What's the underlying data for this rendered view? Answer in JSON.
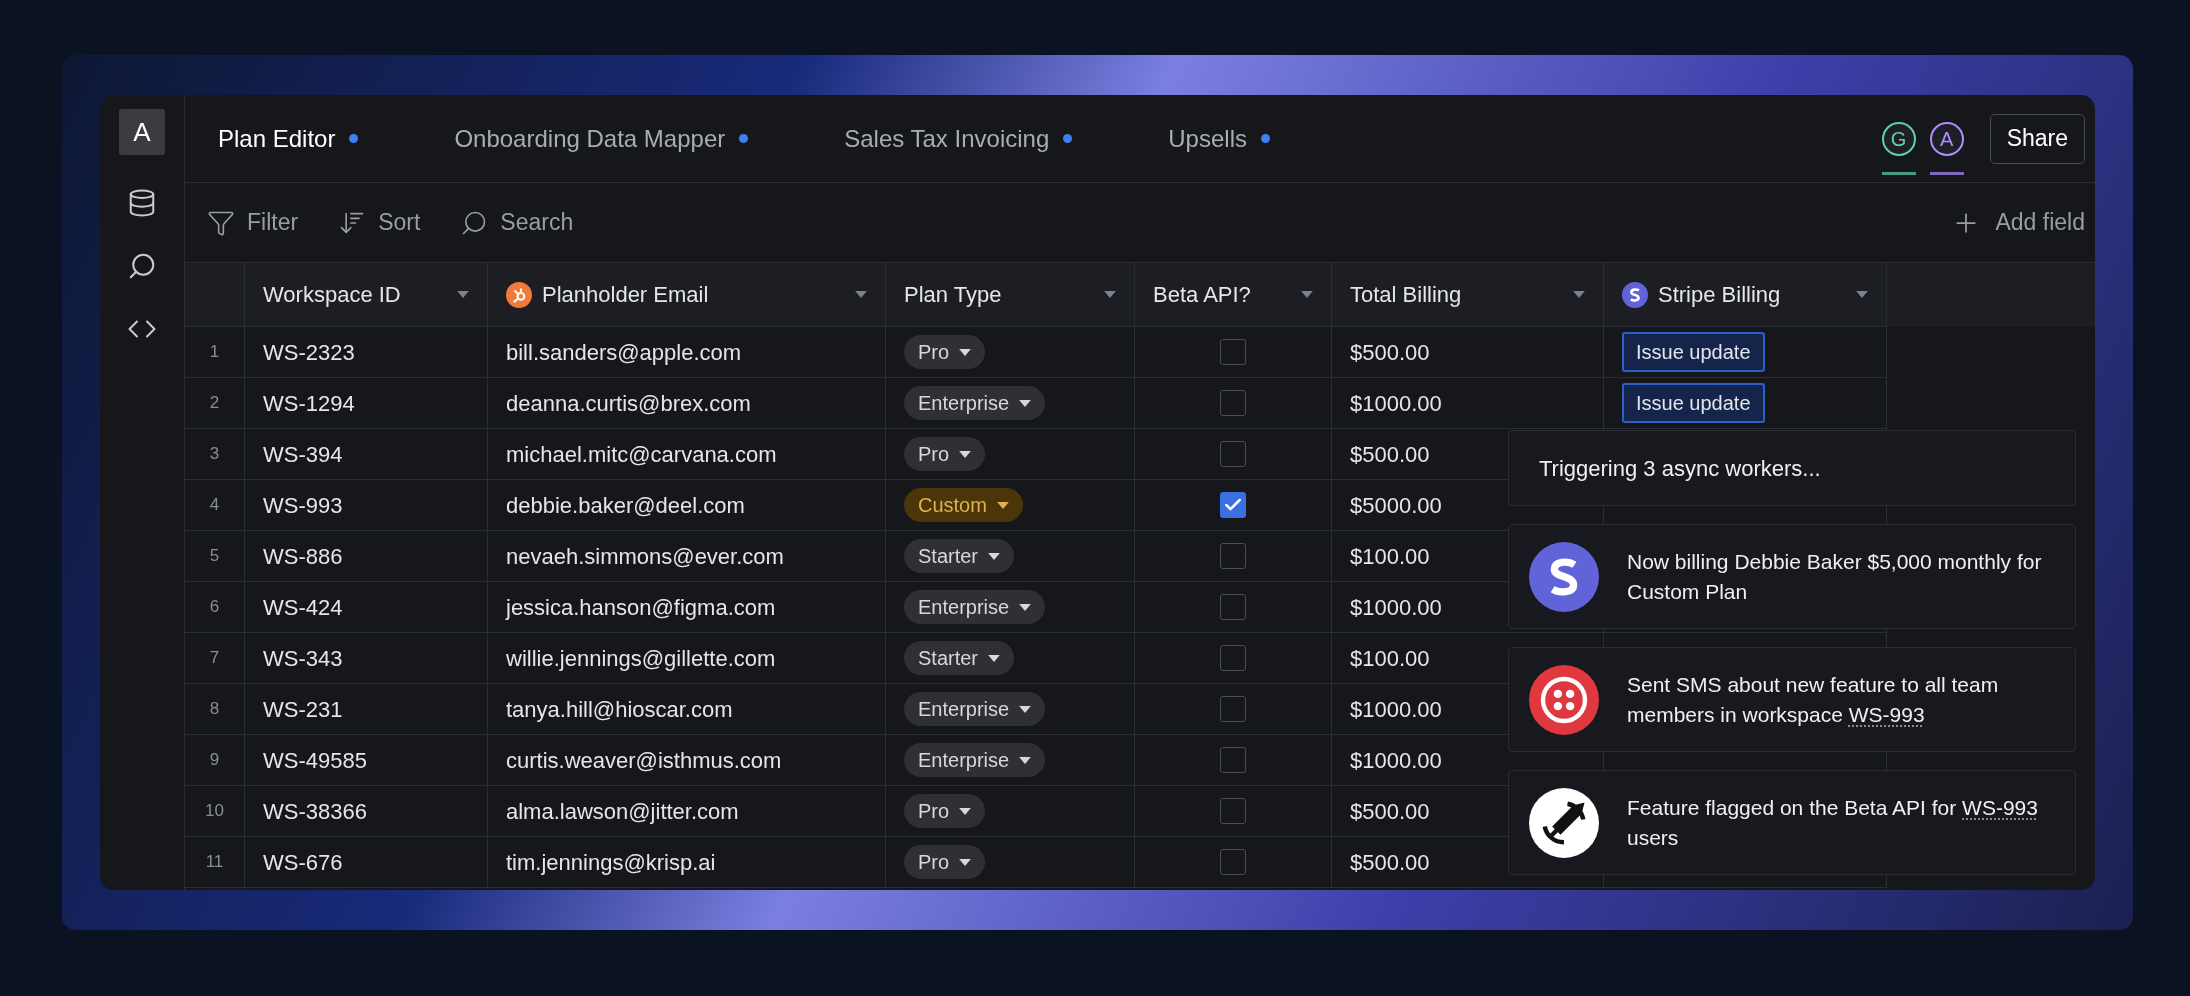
{
  "sidebar": {
    "logo": "A",
    "items": [
      {
        "kind": "database",
        "selected": false
      },
      {
        "kind": "search",
        "selected": false
      },
      {
        "kind": "code",
        "selected": false
      }
    ]
  },
  "tabs": [
    {
      "label": "Plan Editor",
      "selected": true
    },
    {
      "label": "Onboarding Data Mapper",
      "selected": false
    },
    {
      "label": "Sales Tax Invoicing",
      "selected": false
    },
    {
      "label": "Upsells",
      "selected": false
    }
  ],
  "collaborators": [
    {
      "initial": "G",
      "color": "#5fd0b0"
    },
    {
      "initial": "A",
      "color": "#b08cff"
    }
  ],
  "share_button": "Share",
  "toolbar": {
    "filter": "Filter",
    "sort": "Sort",
    "search": "Search",
    "add_field": "Add field"
  },
  "table": {
    "columns": [
      {
        "label": "Workspace ID",
        "kind": "plain"
      },
      {
        "label": "Planholder Email",
        "kind": "hubspot"
      },
      {
        "label": "Plan Type",
        "kind": "plain"
      },
      {
        "label": "Beta API?",
        "kind": "plain"
      },
      {
        "label": "Total Billing",
        "kind": "plain"
      },
      {
        "label": "Stripe Billing",
        "kind": "stripe"
      }
    ],
    "rows": [
      {
        "number": "1",
        "id": "WS-2323",
        "email": "bill.sanders@apple.com",
        "plan": {
          "label": "Pro",
          "color": "#2f3034"
        },
        "beta": false,
        "billing": "$500.00",
        "action": "Issue update"
      },
      {
        "number": "2",
        "id": "WS-1294",
        "email": "deanna.curtis@brex.com",
        "plan": {
          "label": "Enterprise",
          "color": "#2f3034"
        },
        "beta": false,
        "billing": "$1000.00",
        "action": "Issue update"
      },
      {
        "number": "3",
        "id": "WS-394",
        "email": "michael.mitc@carvana.com",
        "plan": {
          "label": "Pro",
          "color": "#2f3034"
        },
        "beta": false,
        "billing": "$500.00"
      },
      {
        "number": "4",
        "id": "WS-993",
        "email": "debbie.baker@deel.com",
        "plan": {
          "label": "Custom",
          "color": "#4a3608"
        },
        "beta": true,
        "billing": "$5000.00"
      },
      {
        "number": "5",
        "id": "WS-886",
        "email": "nevaeh.simmons@ever.com",
        "plan": {
          "label": "Starter",
          "color": "#2f3034"
        },
        "beta": false,
        "billing": "$100.00"
      },
      {
        "number": "6",
        "id": "WS-424",
        "email": "jessica.hanson@figma.com",
        "plan": {
          "label": "Enterprise",
          "color": "#2f3034"
        },
        "beta": false,
        "billing": "$1000.00"
      },
      {
        "number": "7",
        "id": "WS-343",
        "email": "willie.jennings@gillette.com",
        "plan": {
          "label": "Starter",
          "color": "#2f3034"
        },
        "beta": false,
        "billing": "$100.00"
      },
      {
        "number": "8",
        "id": "WS-231",
        "email": "tanya.hill@hioscar.com",
        "plan": {
          "label": "Enterprise",
          "color": "#2f3034"
        },
        "beta": false,
        "billing": "$1000.00"
      },
      {
        "number": "9",
        "id": "WS-49585",
        "email": "curtis.weaver@isthmus.com",
        "plan": {
          "label": "Enterprise",
          "color": "#2f3034"
        },
        "beta": false,
        "billing": "$1000.00"
      },
      {
        "number": "10",
        "id": "WS-38366",
        "email": "alma.lawson@jitter.com",
        "plan": {
          "label": "Pro",
          "color": "#2f3034"
        },
        "beta": false,
        "billing": "$500.00"
      },
      {
        "number": "11",
        "id": "WS-676",
        "email": "tim.jennings@krisp.ai",
        "plan": {
          "label": "Pro",
          "color": "#2f3034"
        },
        "beta": false,
        "billing": "$500.00"
      }
    ]
  },
  "notifications": {
    "status": "Triggering 3 async workers...",
    "items": [
      {
        "kind": "stripe",
        "segments": [
          {
            "text": "Now billing Debbie Baker $5,000 monthly for Custom Plan",
            "link": false
          }
        ]
      },
      {
        "kind": "twilio",
        "segments": [
          {
            "text": "Sent SMS about new feature to all team members in workspace",
            "link": false
          },
          {
            "text": "WS-993",
            "link": true
          }
        ]
      },
      {
        "kind": "rocket",
        "segments": [
          {
            "text": "Feature flagged on the Beta API for",
            "link": false
          },
          {
            "text": "WS-993",
            "link": true
          },
          {
            "text": "users",
            "link": false
          }
        ]
      }
    ]
  }
}
